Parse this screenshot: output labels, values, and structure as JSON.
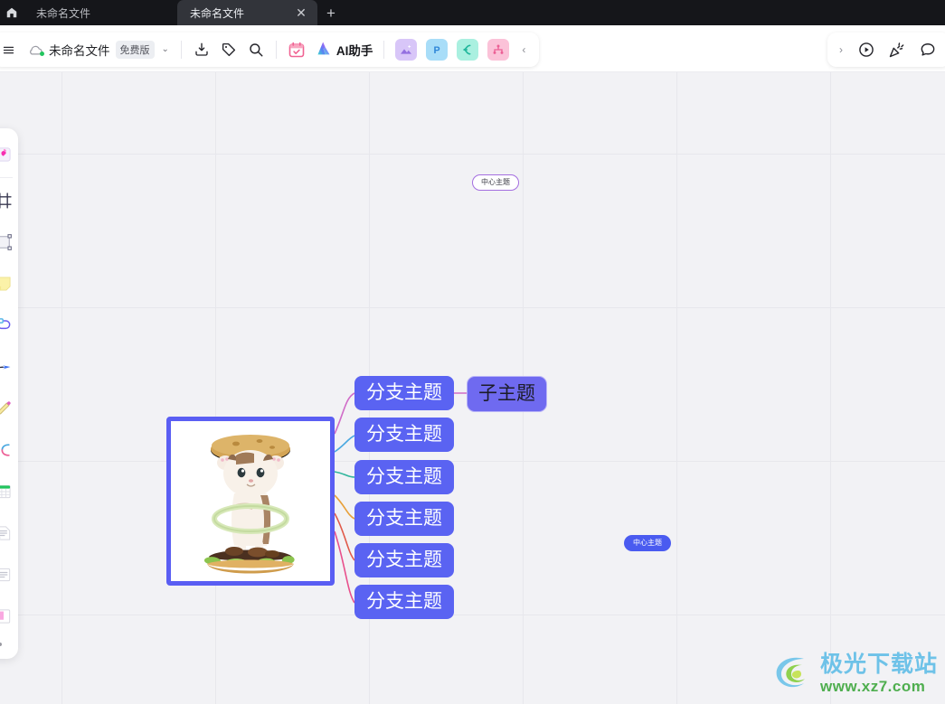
{
  "browser": {
    "home_icon": "home-icon",
    "tabs": [
      {
        "title": "未命名文件",
        "active": false
      },
      {
        "title": "未命名文件",
        "active": true
      }
    ],
    "close_glyph": "✕",
    "new_tab_glyph": "+"
  },
  "toolbar": {
    "menu_icon": "menu-icon",
    "cloud_icon": "cloud-sync-icon",
    "doc_name": "未命名文件",
    "free_badge": "免费版",
    "dropdown_glyph": "⌄",
    "export_icon": "download-icon",
    "tag_icon": "tag-icon",
    "search_icon": "search-icon",
    "calendar_icon": "calendar-icon",
    "ai_icon": "ai-logo-icon",
    "ai_label": "AI助手",
    "color_buttons": [
      {
        "name": "image-insert-icon",
        "color": "#c9b6f5"
      },
      {
        "name": "ppt-export-icon",
        "color": "#9fd9f7"
      },
      {
        "name": "mindmap-left-icon",
        "color": "#a6f0df"
      },
      {
        "name": "structure-tree-icon",
        "color": "#f9c0d8"
      }
    ],
    "collapse_glyph": "‹",
    "expand_glyph": "›",
    "present_icon": "play-circle-icon",
    "celebrate_icon": "party-popper-icon",
    "comment_icon": "comment-bubble-icon"
  },
  "tool_rail": {
    "items": [
      {
        "name": "sticker-icon"
      },
      {
        "name": "frame-icon"
      },
      {
        "name": "shape-icon"
      },
      {
        "name": "sticky-note-icon"
      },
      {
        "name": "mindmap-icon"
      },
      {
        "name": "arrow-icon"
      },
      {
        "name": "pen-icon"
      },
      {
        "name": "curve-connector-icon"
      },
      {
        "name": "table-icon"
      },
      {
        "name": "document-icon"
      },
      {
        "name": "text-block-icon"
      },
      {
        "name": "card-icon"
      }
    ],
    "more_dot": "more-dot-icon"
  },
  "mindmap": {
    "central_topic_outline": "中心主题",
    "central_topic_filled": "中心主题",
    "branch_label": "分支主题",
    "sub_label": "子主题",
    "branches": [
      {
        "label": "分支主题",
        "connector_color": "#d06cc8"
      },
      {
        "label": "分支主题",
        "connector_color": "#4aa8e0"
      },
      {
        "label": "分支主题",
        "connector_color": "#2fb59c"
      },
      {
        "label": "分支主题",
        "connector_color": "#e8a03a"
      },
      {
        "label": "分支主题",
        "connector_color": "#e05a4a"
      },
      {
        "label": "分支主题",
        "connector_color": "#e8508c"
      }
    ],
    "image_node": {
      "name": "cat-burger-illustration",
      "selected": true,
      "border_color": "#5a5ef3"
    },
    "node_colors": {
      "branch_fill": "#5a63f2",
      "sub_fill": "#6f6af0",
      "central_filled": "#4a5bf0",
      "central_outline_border": "#a46ee0"
    }
  },
  "watermark": {
    "title": "极光下载站",
    "url": "www.xz7.com",
    "logo_icon": "aurora-logo-icon"
  }
}
